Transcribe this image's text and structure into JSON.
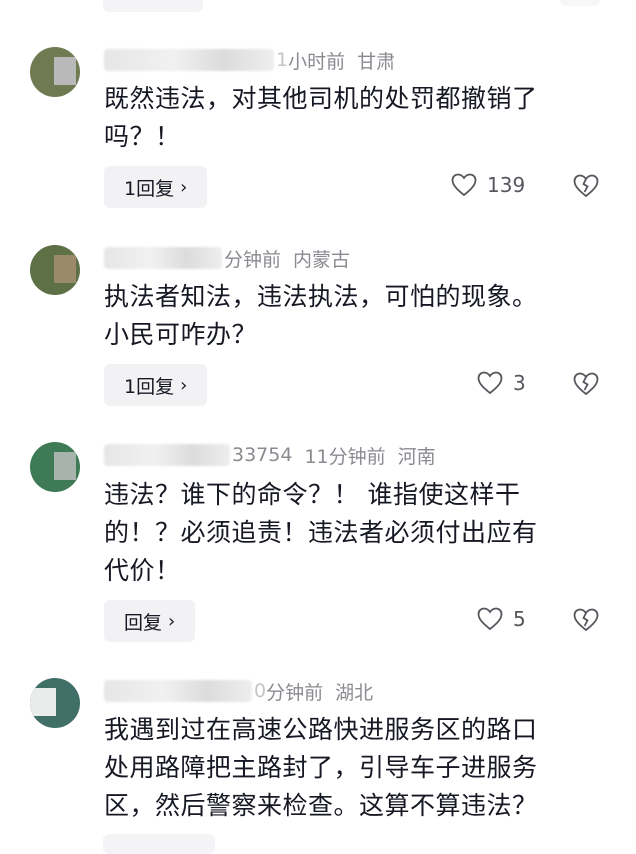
{
  "comments": [
    {
      "time": "小时前",
      "time_prefix": "1",
      "location": "甘肃",
      "text_lines": [
        "既然违法，对其他司机的处罚都撤销了",
        "吗？！"
      ],
      "reply_label": "1回复",
      "likes": "139",
      "avatar_color": "#6f7a52"
    },
    {
      "time": "分钟前",
      "location": "内蒙古",
      "text_lines": [
        "执法者知法，违法执法，可怕的现象。",
        "小民可咋办？"
      ],
      "reply_label": "1回复",
      "likes": "3",
      "avatar_color": "#5d7046"
    },
    {
      "name_suffix": "33754",
      "time": "11分钟前",
      "location": "河南",
      "text_lines": [
        "违法？谁下的命令？！ 谁指使这样干",
        "的！？必须追责！违法者必须付出应有",
        "代价！"
      ],
      "reply_label": "回复",
      "likes": "5",
      "avatar_color": "#3d7a55"
    },
    {
      "time": "分钟前",
      "time_prefix": "0",
      "location": "湖北",
      "text_lines": [
        "我遇到过在高速公路快进服务区的路口",
        "处用路障把主路封了，引导车子进服务",
        "区，然后警察来检查。这算不算违法？"
      ],
      "avatar_color": "#3f6f66"
    }
  ],
  "icons": {
    "reply_chevron": "chevron-right-icon",
    "like": "heart-outline-icon",
    "dislike": "broken-heart-icon"
  },
  "colors": {
    "text": "#161823",
    "meta": "#8a8b91",
    "button_bg": "#f2f2f4"
  }
}
